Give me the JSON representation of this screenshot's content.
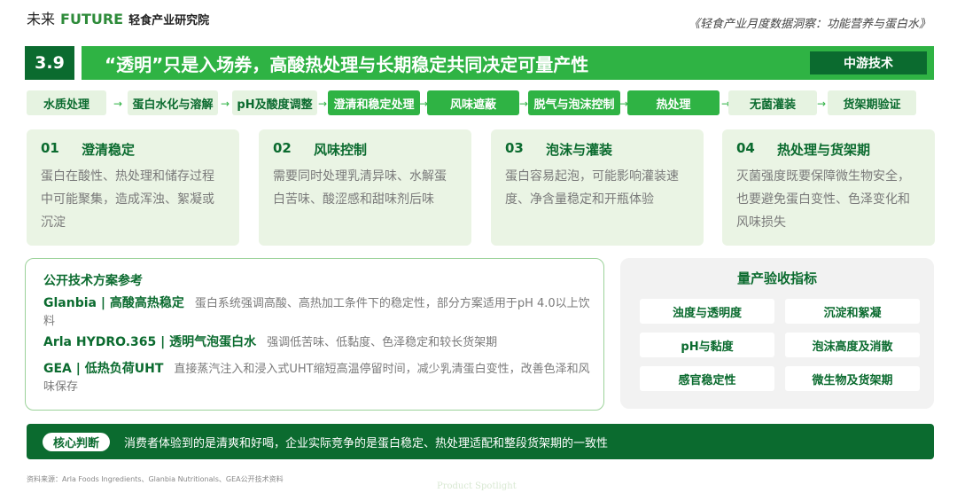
{
  "header": {
    "logo_cn": "未来",
    "logo_en": "FUTURE",
    "logo_org": "轻食产业研究院",
    "report_title": "《轻食产业月度数据洞察：功能营养与蛋白水》"
  },
  "section": {
    "number": "3.9",
    "title": "“透明”只是入场券，高酸热处理与长期稳定共同决定可量产性",
    "tag": "中游技术"
  },
  "flow": {
    "arrow": "→",
    "steps": [
      {
        "label": "水质处理",
        "active": false
      },
      {
        "label": "蛋白水化与溶解",
        "active": false
      },
      {
        "label": "pH及酸度调整",
        "active": false
      },
      {
        "label": "澄清和稳定处理",
        "active": true
      },
      {
        "label": "风味遮蔽",
        "active": true
      },
      {
        "label": "脱气与泡沫控制",
        "active": true
      },
      {
        "label": "热处理",
        "active": true
      },
      {
        "label": "无菌灌装",
        "active": false
      },
      {
        "label": "货架期验证",
        "active": false
      }
    ]
  },
  "cards": [
    {
      "num": "01",
      "title": "澄清稳定",
      "body": "蛋白在酸性、热处理和储存过程中可能聚集，造成浑浊、絮凝或沉淀"
    },
    {
      "num": "02",
      "title": "风味控制",
      "body": "需要同时处理乳清异味、水解蛋白苦味、酸涩感和甜味剂后味"
    },
    {
      "num": "03",
      "title": "泡沫与灌装",
      "body": "蛋白容易起泡，可能影响灌装速度、净含量稳定和开瓶体验"
    },
    {
      "num": "04",
      "title": "热处理与货架期",
      "body": "灭菌强度既要保障微生物安全，也要避免蛋白变性、色泽变化和风味损失"
    }
  ],
  "reference": {
    "title": "公开技术方案参考",
    "items": [
      {
        "label": "Glanbia | 高酸高热稳定",
        "desc": "蛋白系统强调高酸、高热加工条件下的稳定性，部分方案适用于pH 4.0以上饮料"
      },
      {
        "label": "Arla HYDRO.365 | 透明气泡蛋白水",
        "desc": "强调低苦味、低黏度、色泽稳定和较长货架期"
      },
      {
        "label": "GEA | 低热负荷UHT",
        "desc": "直接蒸汽注入和浸入式UHT缩短高温停留时间，减少乳清蛋白变性，改善色泽和风味保存"
      }
    ]
  },
  "kpi": {
    "title": "量产验收指标",
    "items": [
      "浊度与透明度",
      "沉淀和絮凝",
      "pH与黏度",
      "泡沫高度及消散",
      "感官稳定性",
      "微生物及货架期"
    ]
  },
  "judgement": {
    "label": "核心判断",
    "text": "消费者体验到的是清爽和好喝，企业实际竞争的是蛋白稳定、热处理适配和整段货架期的一致性"
  },
  "source": "资料来源：Arla Foods Ingredients、Glanbia Nutritionals、GEA公开技术资料",
  "watermark": "Product Spotlight",
  "colors": {
    "dark_green": "#0b6b2f",
    "green": "#2fb344",
    "light_green": "#eaf4e4",
    "gray_panel": "#f2f2f2"
  }
}
